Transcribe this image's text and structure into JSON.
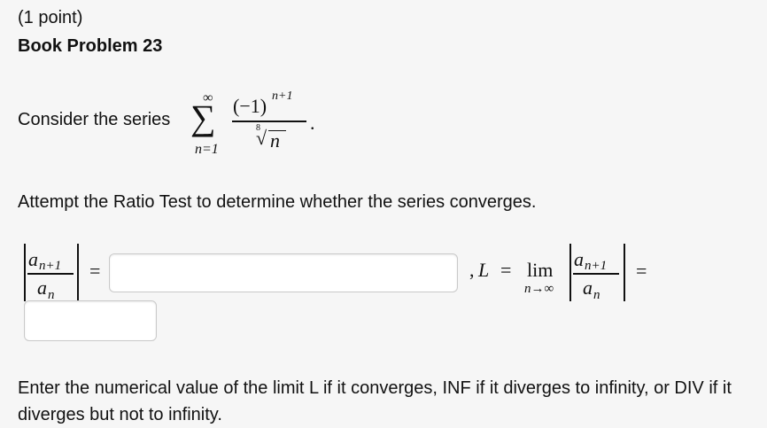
{
  "header": {
    "points": "(1 point)",
    "problem_title": "Book Problem 23"
  },
  "series": {
    "intro": "Consider the series",
    "sum_sign": "∑",
    "upper_limit": "∞",
    "lower_limit": "n=1",
    "numerator_base": "(−1)",
    "numerator_exponent": "n+1",
    "denominator_root_index": "8",
    "denominator_radical": "√",
    "denominator_radicand": "n",
    "period": "."
  },
  "instruction": "Attempt the Ratio Test to determine whether the series converges.",
  "ratio": {
    "numerator": "a",
    "numerator_sub": "n+1",
    "denominator": "a",
    "denominator_sub": "n",
    "equals": "=",
    "ratio_input_value": "",
    "comma": ",",
    "L": "L",
    "equals2": "=",
    "lim": "lim",
    "lim_sub": "n→∞",
    "equals3": "=",
    "limit_input_value": ""
  },
  "footer": "Enter the numerical value of the limit L if it converges, INF if it diverges to infinity, or DIV if it diverges but not to infinity."
}
